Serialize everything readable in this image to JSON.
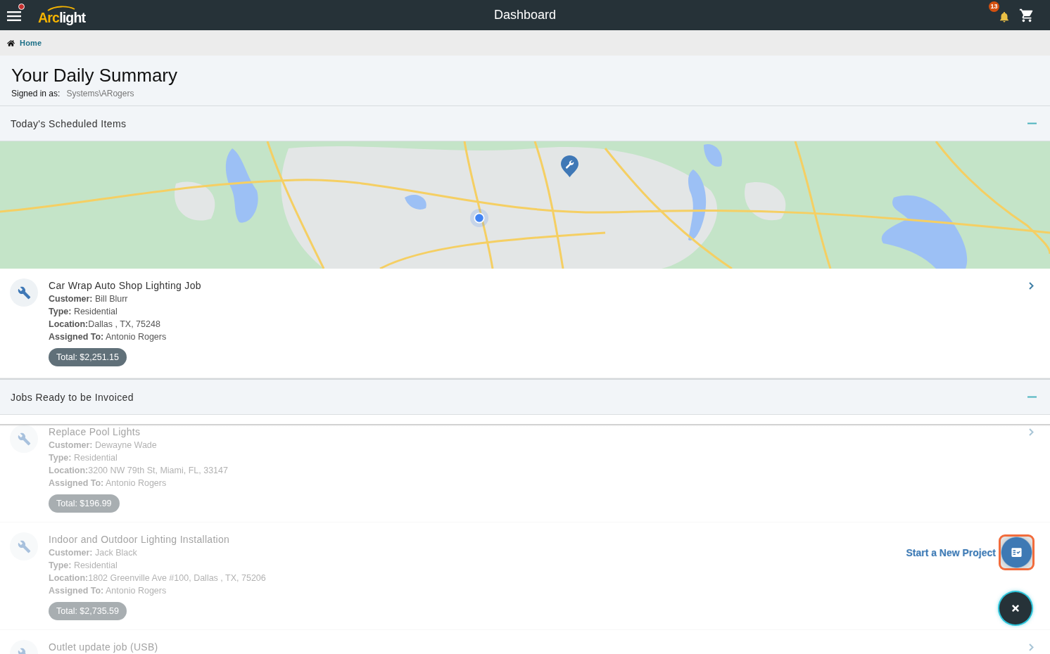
{
  "app_bar": {
    "menu_alert": true,
    "logo": {
      "accent": "Arc",
      "rest": "light"
    },
    "title": "Dashboard",
    "notification_count": "13"
  },
  "breadcrumb": [
    {
      "label": "Home"
    }
  ],
  "summary": {
    "title": "Your Daily Summary",
    "signed_in_label": "Signed in as:",
    "signed_in_user": "Systems\\ARogers"
  },
  "sections": [
    {
      "title": "Today's Scheduled Items",
      "expanded": true,
      "dimmed": false,
      "map": true,
      "items": [
        {
          "title": "Car Wrap Auto Shop Lighting Job",
          "lines": [
            "**Customer:** Bill Blurr",
            "**Type:** Residential",
            "**Location:**Dallas , TX, 75248",
            "**Assigned To:** Antonio Rogers"
          ],
          "total": "Total: $2,251.15"
        }
      ]
    },
    {
      "title": "Jobs Ready to be Invoiced",
      "expanded": true,
      "dimmed": true,
      "items": [
        {
          "title": "Replace Pool Lights",
          "lines": [
            "**Customer:** Dewayne Wade",
            "**Type:** Residential",
            "**Location:**3200 NW 79th St, Miami, FL, 33147",
            "**Assigned To:** Antonio Rogers"
          ],
          "total": "Total: $196.99"
        },
        {
          "title": "Indoor and Outdoor Lighting Installation",
          "lines": [
            "**Customer:** Jack Black",
            "**Type:** Residential",
            "**Location:**1802 Greenville Ave #100, Dallas , TX, 75206",
            "**Assigned To:** Antonio Rogers"
          ],
          "total": "Total: $2,735.59"
        },
        {
          "title": "Outlet update job (USB)"
        }
      ]
    }
  ],
  "fab_menu": {
    "open": true,
    "actions": [
      {
        "label": "Start a New Project",
        "focused": true
      }
    ]
  }
}
